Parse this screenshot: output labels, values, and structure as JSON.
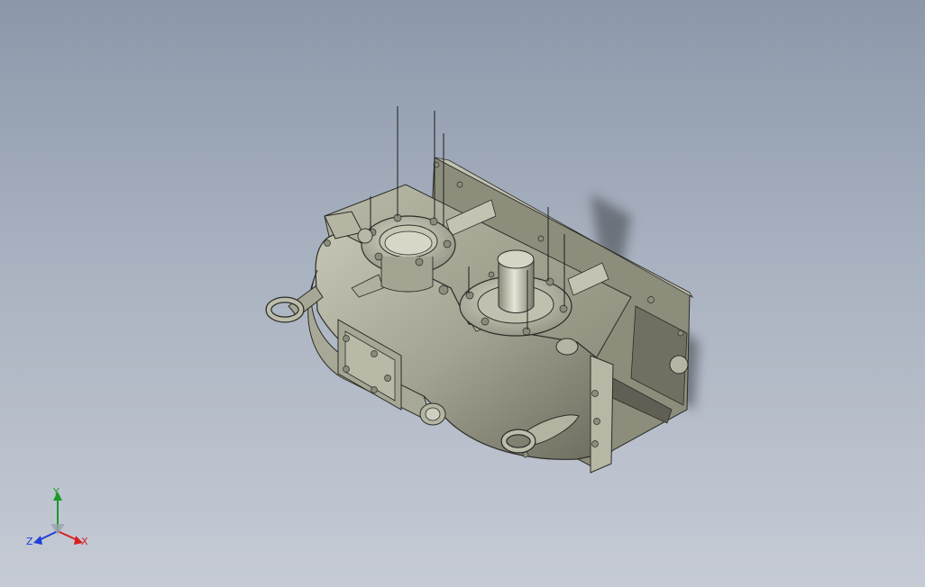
{
  "viewport": {
    "background_top": "#8c98aa",
    "background_bottom": "#c6cbd5"
  },
  "model": {
    "name_icon": "gearbox-3d-model",
    "body_color": "#9c9c8a",
    "shadow_color": "#5a5f66"
  },
  "triad": {
    "x_label": "X",
    "y_label": "Y",
    "z_label": "Z",
    "x_color": "#d81f1f",
    "y_color": "#1a9a2a",
    "z_color": "#1f3fd8"
  }
}
